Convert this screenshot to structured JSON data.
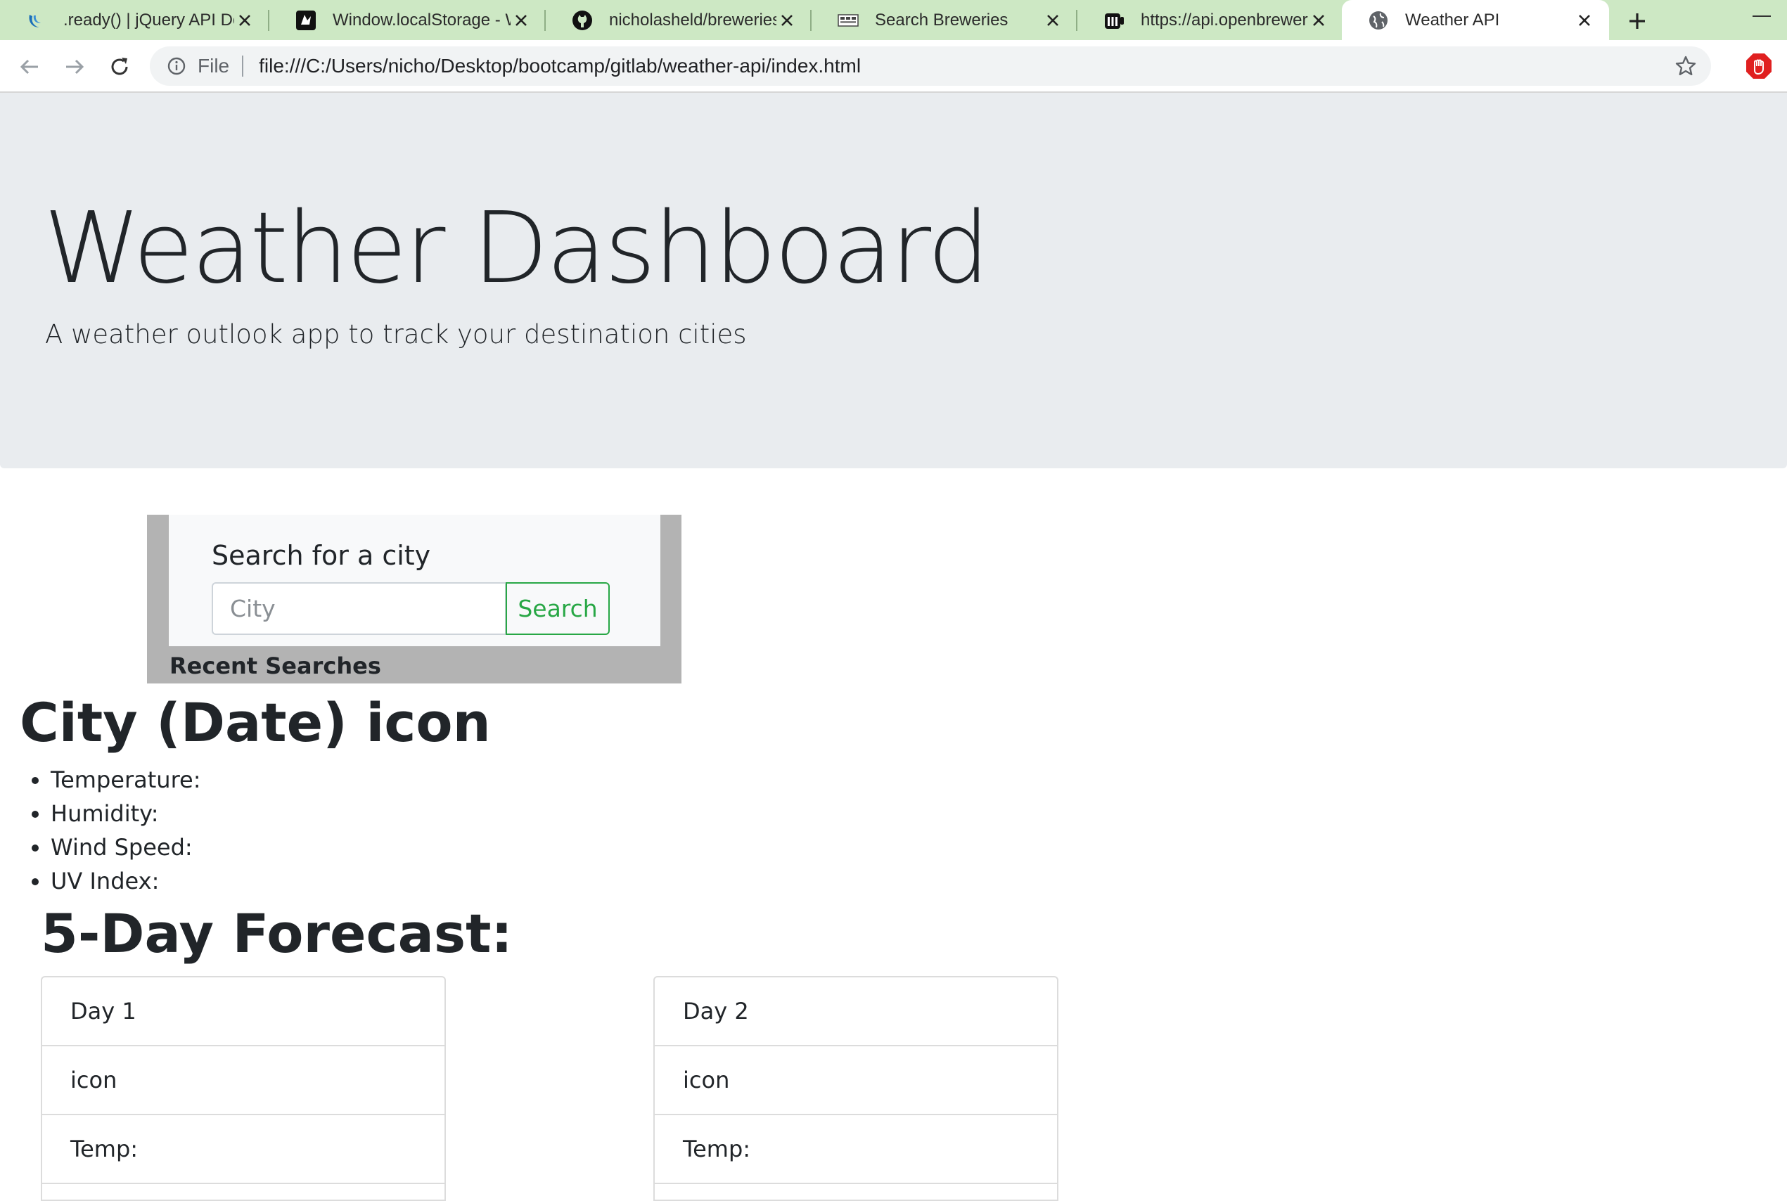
{
  "browser": {
    "tabs": [
      {
        "title": ".ready() | jQuery API Do",
        "favicon": "jquery-icon",
        "active": false
      },
      {
        "title": "Window.localStorage - W",
        "favicon": "mdn-icon",
        "active": false
      },
      {
        "title": "nicholasheld/breweries-",
        "favicon": "github-icon",
        "active": false
      },
      {
        "title": "Search Breweries",
        "favicon": "breweries-icon",
        "active": false
      },
      {
        "title": "https://api.openbrewery",
        "favicon": "openbrewery-icon",
        "active": false
      },
      {
        "title": "Weather API",
        "favicon": "globe-icon",
        "active": true
      }
    ],
    "address_bar": {
      "scheme_label": "File",
      "url": "file:///C:/Users/nicho/Desktop/bootcamp/gitlab/weather-api/index.html"
    },
    "colors": {
      "tab_strip": "#cde8c4",
      "accent_green": "#28a745"
    }
  },
  "page": {
    "header": {
      "title": "Weather Dashboard",
      "subtitle": "A weather outlook app to track your destination cities"
    },
    "search": {
      "label": "Search for a city",
      "input_placeholder": "City",
      "input_value": "",
      "button_label": "Search",
      "recent_label": "Recent Searches"
    },
    "current": {
      "title": "City (Date) icon",
      "items": [
        "Temperature:",
        "Humidity:",
        "Wind Speed:",
        "UV Index:"
      ]
    },
    "forecast": {
      "title": "5-Day Forecast:",
      "days": [
        {
          "day": "Day 1",
          "icon": "icon",
          "temp": "Temp:"
        },
        {
          "day": "Day 2",
          "icon": "icon",
          "temp": "Temp:"
        }
      ]
    }
  }
}
